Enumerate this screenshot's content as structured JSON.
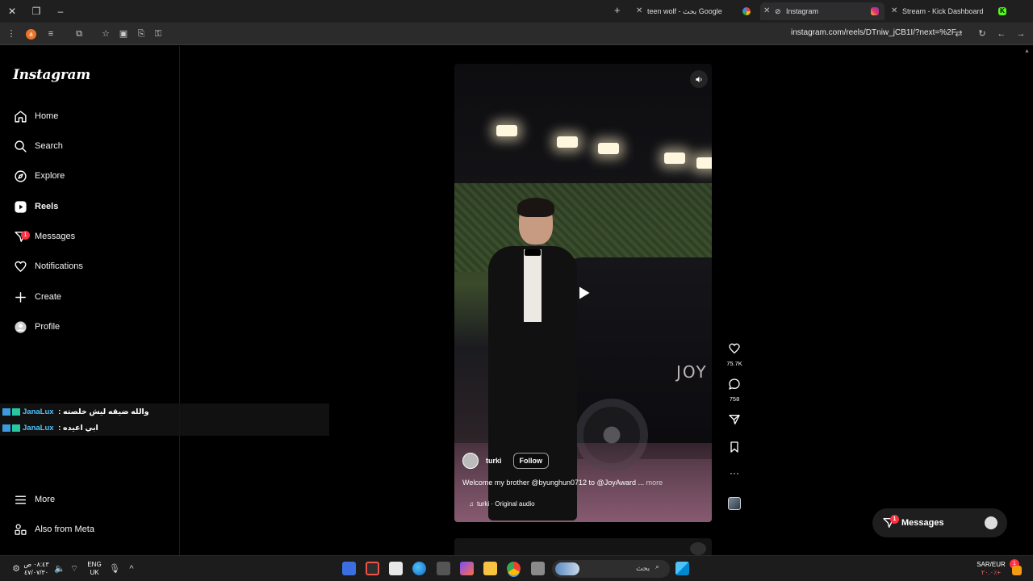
{
  "browser": {
    "tabs": [
      {
        "title": "teen wolf - بحث Google",
        "active": false
      },
      {
        "title": "Instagram",
        "active": true
      },
      {
        "title": "Stream - Kick Dashboard",
        "active": false
      }
    ],
    "url": "instagram.com/reels/DTniw_jCB1I/?next=%2F"
  },
  "sidebar": {
    "logo": "Instagram",
    "items": [
      {
        "label": "Home",
        "icon": "home-icon"
      },
      {
        "label": "Search",
        "icon": "search-icon"
      },
      {
        "label": "Explore",
        "icon": "compass-icon"
      },
      {
        "label": "Reels",
        "icon": "reels-icon",
        "active": true
      },
      {
        "label": "Messages",
        "icon": "messenger-icon",
        "badge": "1"
      },
      {
        "label": "Notifications",
        "icon": "heart-icon"
      },
      {
        "label": "Create",
        "icon": "plus-icon"
      },
      {
        "label": "Profile",
        "icon": "avatar-icon"
      }
    ],
    "more": "More",
    "also_from_meta": "Also from Meta"
  },
  "chat": [
    {
      "user": "JanaLux",
      "sep": " : ",
      "message": "والله ضيقه ليش خلصته"
    },
    {
      "user": "JanaLux",
      "sep": " : ",
      "message": "ابي اعيده"
    }
  ],
  "reel": {
    "username": "turki",
    "follow_label": "Follow",
    "caption": "Welcome my brother @byunghun0712 to @JoyAward",
    "caption_ellipsis": "...",
    "more_label": "more",
    "audio": "turki · Original audio",
    "car_text": "JOY",
    "likes": "75.7K",
    "comments": "758"
  },
  "messages_pill": {
    "label": "Messages",
    "badge": "1"
  },
  "taskbar": {
    "time": "٠٨:٤٣ ص",
    "date": "٤٧/٠٧/٣٠",
    "lang_line1": "ENG",
    "lang_line2": "UK",
    "search_placeholder": "بحث",
    "ticker_name": "SAR/EUR",
    "ticker_value": "٢٠.٠٪+",
    "ticker_badge": "1"
  },
  "colors": {
    "accent_badge": "#ff3040",
    "background": "#000000",
    "kick_green": "#53fc18"
  }
}
